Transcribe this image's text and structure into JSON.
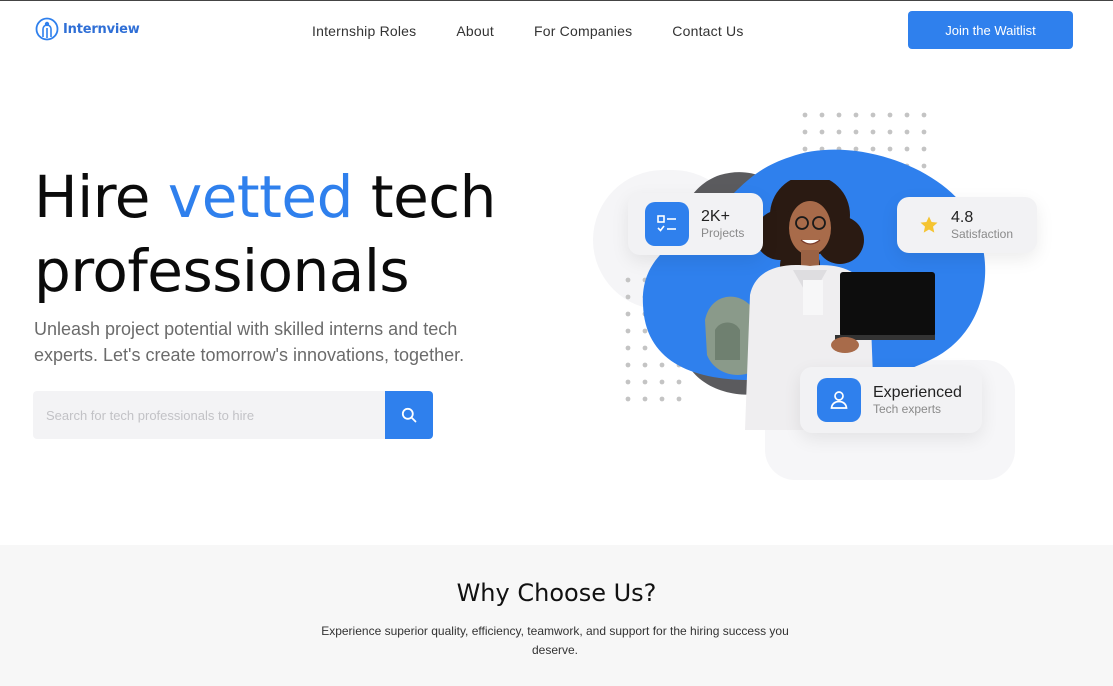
{
  "brand": {
    "name": "Internview",
    "color": "#2f80ed"
  },
  "nav": {
    "links": [
      "Internship Roles",
      "About",
      "For Companies",
      "Contact Us"
    ],
    "cta": "Join the Waitlist"
  },
  "hero": {
    "title_part1": "Hire ",
    "title_accent": "vetted",
    "title_part2": " tech",
    "title_line2": "professionals",
    "subtitle": "Unleash project potential with skilled interns and tech experts. Let's create tomorrow's innovations, together.",
    "search": {
      "placeholder": "Search for tech professionals to hire",
      "value": ""
    }
  },
  "stats": {
    "projects": {
      "value": "2K+",
      "label": "Projects",
      "icon": "checklist-icon"
    },
    "rating": {
      "value": "4.8",
      "label": "Satisfaction",
      "icon": "star-icon"
    },
    "experience": {
      "value": "Experienced",
      "label": "Tech experts",
      "icon": "user-icon"
    }
  },
  "why": {
    "title": "Why Choose Us?",
    "subtitle": "Experience superior quality, efficiency, teamwork, and support for the hiring success you deserve."
  }
}
